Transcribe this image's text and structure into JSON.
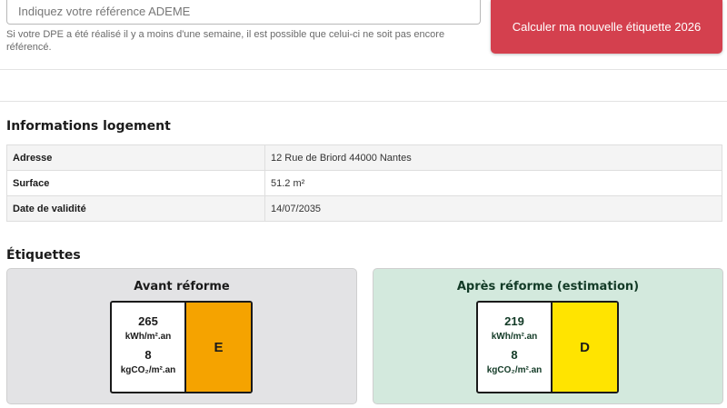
{
  "search": {
    "placeholder": "Indiquez votre référence ADEME",
    "helper_text": "Si votre DPE a été réalisé il y a moins d'une semaine, il est possible que celui-ci ne soit pas encore référencé."
  },
  "actions": {
    "calculate_label": "Calculer ma nouvelle étiquette 2026",
    "calculate_color": "#d4404e"
  },
  "housing": {
    "title": "Informations logement",
    "rows": [
      {
        "label": "Adresse",
        "value": "12 Rue de Briord 44000 Nantes"
      },
      {
        "label": "Surface",
        "value": "51.2 m²"
      },
      {
        "label": "Date de validité",
        "value": "14/07/2035"
      }
    ]
  },
  "labels": {
    "title": "Étiquettes",
    "before": {
      "title": "Avant réforme",
      "energy": "265",
      "energy_unit": "kWh/m².an",
      "ges": "8",
      "ges_unit": "kgCO₂/m².an",
      "grade": "E",
      "grade_color": "#f5a300"
    },
    "after": {
      "title": "Après réforme (estimation)",
      "energy": "219",
      "energy_unit": "kWh/m².an",
      "ges": "8",
      "ges_unit": "kgCO₂/m².an",
      "grade": "D",
      "grade_color": "#ffe400"
    }
  }
}
